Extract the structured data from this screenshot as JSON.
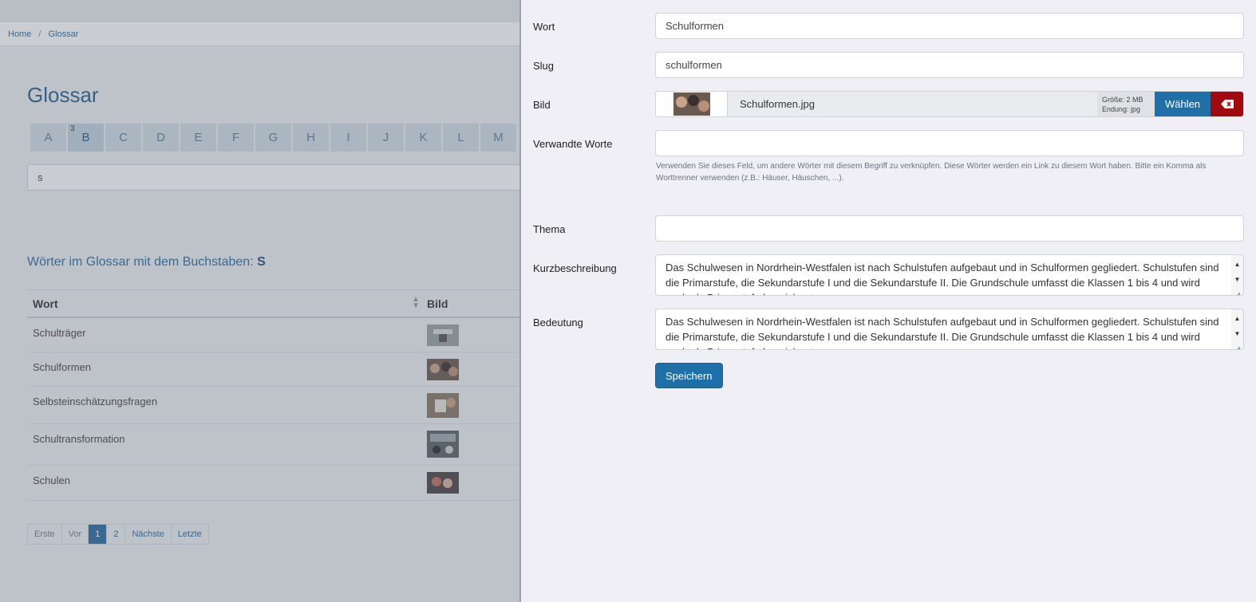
{
  "background": {
    "breadcrumb": {
      "home": "Home",
      "separator": "/",
      "current": "Glossar"
    },
    "title": "Glossar",
    "letters": [
      {
        "label": "A"
      },
      {
        "label": "B",
        "count": "3",
        "active": true
      },
      {
        "label": "C"
      },
      {
        "label": "D"
      },
      {
        "label": "E"
      },
      {
        "label": "F"
      },
      {
        "label": "G"
      },
      {
        "label": "H"
      },
      {
        "label": "I"
      },
      {
        "label": "J"
      },
      {
        "label": "K"
      },
      {
        "label": "L"
      },
      {
        "label": "M"
      }
    ],
    "search_value": "s",
    "subtitle": "Wörter im Glossar mit dem Buchstaben:",
    "subtitle_letter": "S",
    "table": {
      "col_word": "Wort",
      "col_image": "Bild",
      "rows": [
        {
          "word": "Schulträger"
        },
        {
          "word": "Schulformen"
        },
        {
          "word": "Selbsteinschätzungsfragen"
        },
        {
          "word": "Schultransformation"
        },
        {
          "word": "Schulen"
        }
      ]
    },
    "pagination": {
      "first": "Erste",
      "prev": "Vor",
      "page1": "1",
      "page2": "2",
      "next": "Nächste",
      "last": "Letzte"
    }
  },
  "form": {
    "wort_label": "Wort",
    "wort_value": "Schulformen",
    "slug_label": "Slug",
    "slug_value": "schulformen",
    "bild_label": "Bild",
    "bild_filename": "Schulformen.jpg",
    "bild_size": "Größe: 2 MB",
    "bild_ext": "Endung: jpg",
    "bild_choose": "Wählen",
    "verwandte_label": "Verwandte Worte",
    "verwandte_value": "",
    "verwandte_help": "Verwenden Sie dieses Feld, um andere Wörter mit diesem Begriff zu verknüpfen. Diese Wörter werden ein Link zu diesem Wort haben. Bitte ein Komma als Worttrenner verwenden (z.B.: Häuser, Häuschen, ...).",
    "thema_label": "Thema",
    "thema_value": "",
    "kurz_label": "Kurzbeschreibung",
    "kurz_value": "Das Schulwesen in Nordrhein-Westfalen ist nach Schulstufen aufgebaut und in Schulformen gegliedert. Schulstufen sind die Primarstufe, die Sekundarstufe I und die Sekundarstufe II. Die Grundschule umfasst die Klassen 1 bis 4 und wird auch als Primarstufe bezeichnet.",
    "bedeutung_label": "Bedeutung",
    "bedeutung_value": "Das Schulwesen in Nordrhein-Westfalen ist nach Schulstufen aufgebaut und in Schulformen gegliedert. Schulstufen sind die Primarstufe, die Sekundarstufe I und die Sekundarstufe II. Die Grundschule umfasst die Klassen 1 bis 4 und wird auch als Primarstufe bezeichnet.",
    "save_label": "Speichern"
  },
  "colors": {
    "primary": "#1f6fa8",
    "danger": "#a0090d",
    "panel_bg": "#efeff5"
  },
  "icons": {
    "clear": "backspace-x-icon",
    "sort": "sort-icon",
    "scroll_up": "arrow-up-icon",
    "scroll_down": "arrow-down-icon"
  }
}
